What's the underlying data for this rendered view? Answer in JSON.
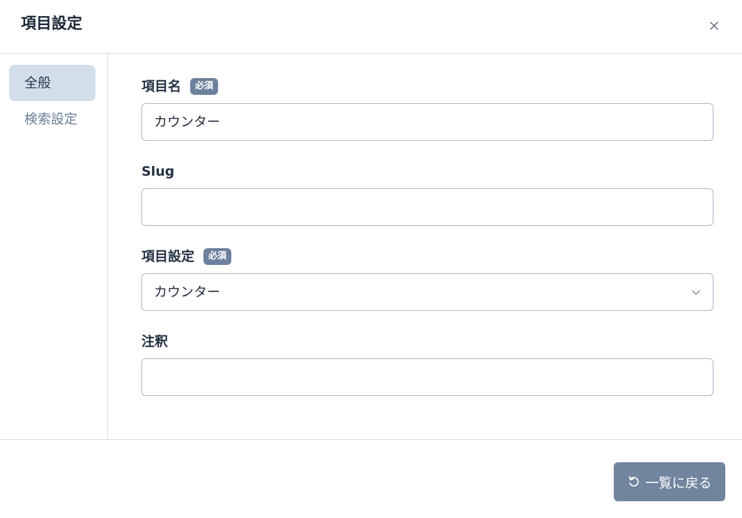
{
  "dialog": {
    "title": "項目設定",
    "close_icon": "close-icon"
  },
  "sidebar": {
    "items": [
      {
        "label": "全般",
        "active": true
      },
      {
        "label": "検索設定",
        "active": false
      }
    ]
  },
  "form": {
    "name": {
      "label": "項目名",
      "badge": "必須",
      "value": "カウンター",
      "placeholder": ""
    },
    "slug": {
      "label": "Slug",
      "value": "",
      "placeholder": ""
    },
    "type": {
      "label": "項目設定",
      "badge": "必須",
      "selected": "カウンター"
    },
    "note": {
      "label": "注釈",
      "value": "",
      "placeholder": ""
    }
  },
  "footer": {
    "back_label": "一覧に戻る",
    "back_icon": "undo-icon"
  },
  "colors": {
    "accent": "#72859f",
    "active_nav": "#d2deea",
    "badge": "#6d809c"
  }
}
